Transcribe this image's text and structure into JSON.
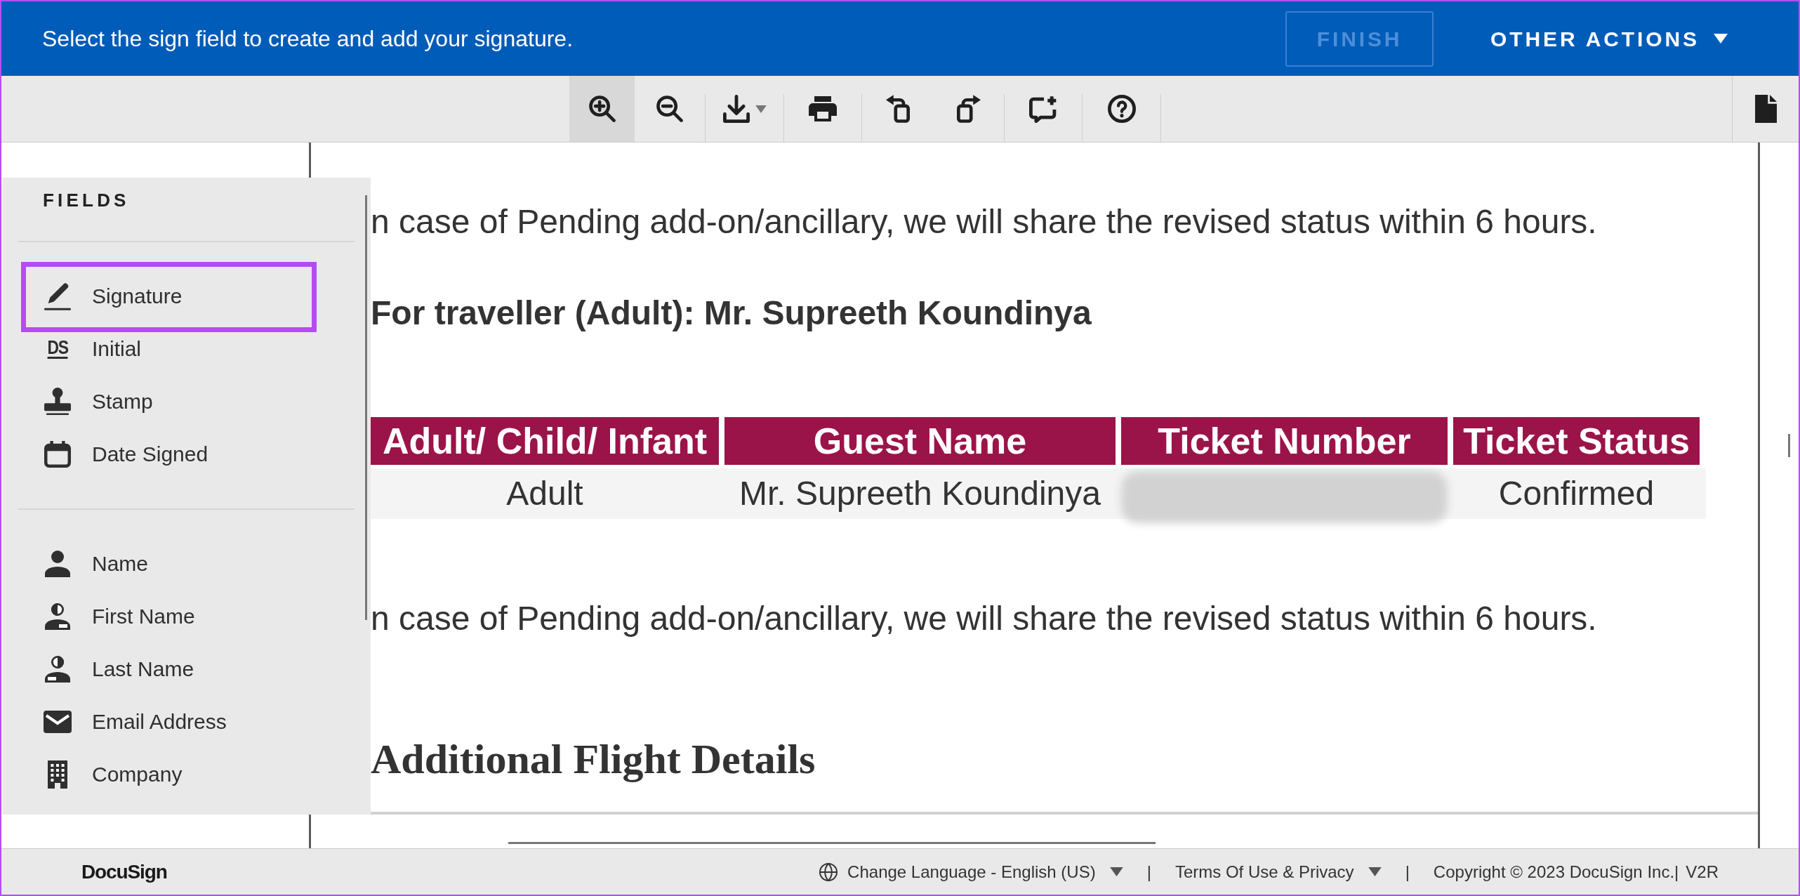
{
  "banner": {
    "message": "Select the sign field to create and add your signature.",
    "finish_button": {
      "label": "FINISH",
      "disabled": true
    },
    "actions_menu": {
      "label": "OTHER ACTIONS"
    }
  },
  "toolbar": {
    "groups": [
      {
        "buttons": [
          {
            "kind": "zoom_in",
            "pressed": true
          },
          {
            "kind": "zoom_out",
            "pressed": false
          }
        ]
      },
      {
        "buttons": [
          {
            "kind": "download",
            "pressed": false
          }
        ]
      },
      {
        "buttons": [
          {
            "kind": "print",
            "pressed": false
          }
        ]
      },
      {
        "buttons": [
          {
            "kind": "rotate_left",
            "pressed": false
          },
          {
            "kind": "rotate_right",
            "pressed": false
          }
        ]
      },
      {
        "buttons": [
          {
            "kind": "comment",
            "pressed": false
          }
        ]
      },
      {
        "buttons": [
          {
            "kind": "help",
            "pressed": false
          }
        ]
      }
    ],
    "end_button": {
      "kind": "document"
    }
  },
  "fields_panel": {
    "title": "FIELDS",
    "groups": [
      {
        "items": [
          {
            "kind": "signature",
            "label": "Signature",
            "highlighted": true
          },
          {
            "kind": "initial",
            "label": "Initial",
            "icon_text": "DS",
            "highlighted": false
          },
          {
            "kind": "stamp",
            "label": "Stamp",
            "highlighted": false
          },
          {
            "kind": "date",
            "label": "Date Signed",
            "highlighted": false
          }
        ]
      },
      {
        "items": [
          {
            "kind": "name",
            "label": "Name",
            "highlighted": false
          },
          {
            "kind": "firstname",
            "label": "First Name",
            "highlighted": false
          },
          {
            "kind": "lastname",
            "label": "Last Name",
            "highlighted": false
          },
          {
            "kind": "email",
            "label": "Email Address",
            "highlighted": false
          },
          {
            "kind": "company",
            "label": "Company",
            "highlighted": false
          }
        ]
      }
    ]
  },
  "document": {
    "blocks": [
      {
        "kind": "paragraph",
        "text": "n case of Pending add-on/ancillary, we will share the revised status within 6 hours."
      },
      {
        "kind": "bold_line",
        "text": "For traveller (Adult): Mr. Supreeth Koundinya"
      },
      {
        "kind": "table",
        "columns": [
          "Adult/ Child/ Infant",
          "Guest Name",
          "Ticket Number",
          "Ticket Status"
        ],
        "rows": [
          {
            "cells": [
              {
                "text": "Adult",
                "redacted": false
              },
              {
                "text": "Mr. Supreeth Koundinya",
                "redacted": false
              },
              {
                "redacted": true
              },
              {
                "text": "Confirmed",
                "redacted": false
              }
            ]
          }
        ]
      },
      {
        "kind": "paragraph",
        "text": "n case of Pending add-on/ancillary, we will share the revised status within 6 hours."
      },
      {
        "kind": "heading",
        "text": "Additional Flight Details"
      }
    ]
  },
  "footer": {
    "logo": "DocuSign",
    "items": [
      {
        "kind": "language",
        "label": "Change Language - English (US)",
        "dropdown": true
      },
      {
        "kind": "separator",
        "label": "|",
        "dropdown": false
      },
      {
        "kind": "link",
        "label": "Terms Of Use & Privacy",
        "dropdown": true
      },
      {
        "kind": "separator",
        "label": "|",
        "dropdown": false
      },
      {
        "kind": "text",
        "label": "Copyright © 2023 DocuSign Inc.|",
        "dropdown": false
      },
      {
        "kind": "text",
        "label": "V2R",
        "dropdown": false
      }
    ]
  }
}
